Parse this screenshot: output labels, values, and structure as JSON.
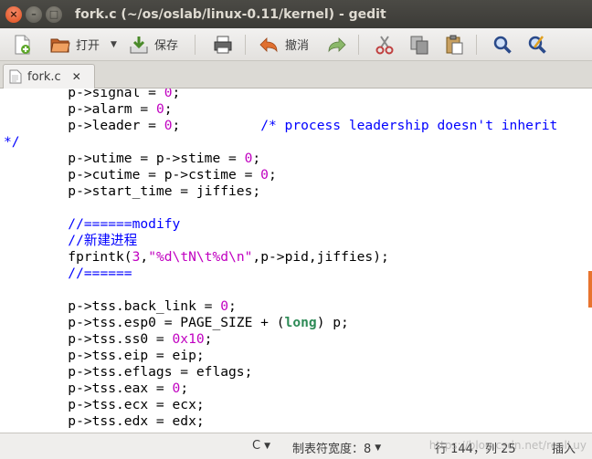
{
  "window": {
    "title": "fork.c (~/os/oslab/linux-0.11/kernel) - gedit",
    "close_glyph": "×",
    "min_glyph": "–",
    "max_glyph": "□"
  },
  "toolbar": {
    "open_label": "打开",
    "save_label": "保存",
    "undo_label": "撤消",
    "dropdown_glyph": "▼"
  },
  "icons": {
    "new": "new-document-icon",
    "open": "open-folder-icon",
    "save": "save-icon",
    "print": "print-icon",
    "undo": "undo-icon",
    "redo": "redo-icon",
    "cut": "cut-icon",
    "copy": "copy-icon",
    "paste": "paste-icon",
    "find": "search-icon",
    "replace": "find-replace-icon"
  },
  "tab": {
    "label": "fork.c",
    "close_glyph": "✕"
  },
  "code_lines": [
    [
      [
        "",
        "\tp->signal = "
      ],
      [
        "num",
        "0"
      ],
      [
        "",
        ";"
      ]
    ],
    [
      [
        "",
        "\tp->alarm = "
      ],
      [
        "num",
        "0"
      ],
      [
        "",
        ";"
      ]
    ],
    [
      [
        "",
        "\tp->leader = "
      ],
      [
        "num",
        "0"
      ],
      [
        "",
        ";\t\t"
      ],
      [
        "cmt",
        "/* process leadership doesn't inherit"
      ]
    ],
    [
      [
        "cmt",
        "*/"
      ]
    ],
    [
      [
        "",
        "\tp->utime = p->stime = "
      ],
      [
        "num",
        "0"
      ],
      [
        "",
        ";"
      ]
    ],
    [
      [
        "",
        "\tp->cutime = p->cstime = "
      ],
      [
        "num",
        "0"
      ],
      [
        "",
        ";"
      ]
    ],
    [
      [
        "",
        "\tp->start_time = jiffies;"
      ]
    ],
    [
      [
        "",
        ""
      ]
    ],
    [
      [
        "",
        "\t"
      ],
      [
        "cmt",
        "//======modify"
      ]
    ],
    [
      [
        "",
        "\t"
      ],
      [
        "cmt",
        "//新建进程"
      ]
    ],
    [
      [
        "",
        "\tfprintk("
      ],
      [
        "num",
        "3"
      ],
      [
        "",
        ","
      ],
      [
        "str",
        "\"%d\\tN\\t%d\\n\""
      ],
      [
        "",
        ",p->pid,jiffies);"
      ]
    ],
    [
      [
        "",
        "\t"
      ],
      [
        "cmt",
        "//======"
      ]
    ],
    [
      [
        "",
        ""
      ]
    ],
    [
      [
        "",
        "\tp->tss.back_link = "
      ],
      [
        "num",
        "0"
      ],
      [
        "",
        ";"
      ]
    ],
    [
      [
        "",
        "\tp->tss.esp0 = PAGE_SIZE + ("
      ],
      [
        "kw",
        "long"
      ],
      [
        "",
        ") p;"
      ]
    ],
    [
      [
        "",
        "\tp->tss.ss0 = "
      ],
      [
        "num",
        "0x10"
      ],
      [
        "",
        ";"
      ]
    ],
    [
      [
        "",
        "\tp->tss.eip = eip;"
      ]
    ],
    [
      [
        "",
        "\tp->tss.eflags = eflags;"
      ]
    ],
    [
      [
        "",
        "\tp->tss.eax = "
      ],
      [
        "num",
        "0"
      ],
      [
        "",
        ";"
      ]
    ],
    [
      [
        "",
        "\tp->tss.ecx = ecx;"
      ]
    ],
    [
      [
        "",
        "\tp->tss.edx = edx;"
      ]
    ]
  ],
  "statusbar": {
    "language": "C",
    "tab_width": "制表符宽度：8",
    "position": "行 144，列 25",
    "mode": "插入",
    "caret_glyph": "▼",
    "watermark": "https://blog.csdn.net/realLuy"
  },
  "colors": {
    "number": "#c000c0",
    "comment": "#0000ff",
    "keyword": "#2e8b57",
    "title_bg": "#3c3b37",
    "scroll_marker": "#e8742e"
  }
}
